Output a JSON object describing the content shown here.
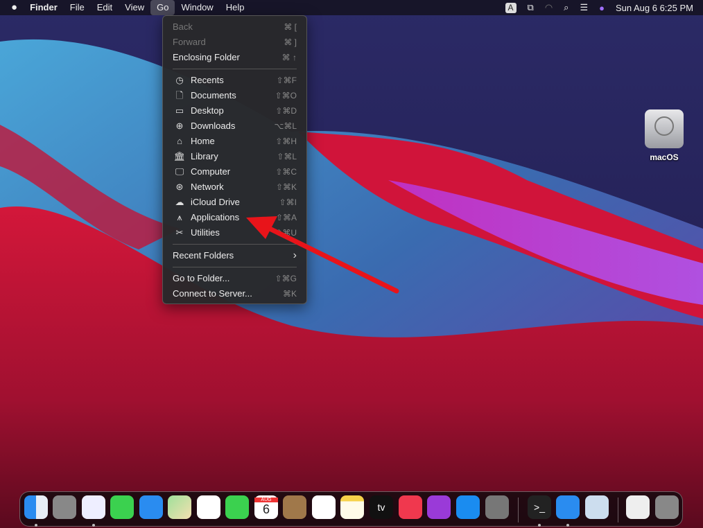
{
  "menubar": {
    "apple": "",
    "app": "Finder",
    "items": [
      "File",
      "Edit",
      "View",
      "Go",
      "Window",
      "Help"
    ],
    "input_source": "A",
    "clock": "Sun Aug 6  6:25 PM"
  },
  "go_menu": {
    "top": [
      {
        "label": "Back",
        "shortcut": "⌘ [",
        "disabled": true
      },
      {
        "label": "Forward",
        "shortcut": "⌘ ]",
        "disabled": true
      },
      {
        "label": "Enclosing Folder",
        "shortcut": "⌘ ↑"
      }
    ],
    "places": [
      {
        "label": "Recents",
        "shortcut": "⇧⌘F",
        "icon": "clock-icon",
        "glyph": "◷"
      },
      {
        "label": "Documents",
        "shortcut": "⇧⌘O",
        "icon": "document-icon",
        "glyph": "🗋"
      },
      {
        "label": "Desktop",
        "shortcut": "⇧⌘D",
        "icon": "desktop-icon",
        "glyph": "▭"
      },
      {
        "label": "Downloads",
        "shortcut": "⌥⌘L",
        "icon": "download-icon",
        "glyph": "⊕"
      },
      {
        "label": "Home",
        "shortcut": "⇧⌘H",
        "icon": "home-icon",
        "glyph": "⌂"
      },
      {
        "label": "Library",
        "shortcut": "⇧⌘L",
        "icon": "library-icon",
        "glyph": "🏛"
      },
      {
        "label": "Computer",
        "shortcut": "⇧⌘C",
        "icon": "computer-icon",
        "glyph": "🖵"
      },
      {
        "label": "Network",
        "shortcut": "⇧⌘K",
        "icon": "globe-icon",
        "glyph": "⊛"
      },
      {
        "label": "iCloud Drive",
        "shortcut": "⇧⌘I",
        "icon": "cloud-icon",
        "glyph": "☁"
      },
      {
        "label": "Applications",
        "shortcut": "⇧⌘A",
        "icon": "applications-icon",
        "glyph": "⩚"
      },
      {
        "label": "Utilities",
        "shortcut": "⇧⌘U",
        "icon": "tools-icon",
        "glyph": "✂"
      }
    ],
    "recent_folders": "Recent Folders",
    "submenu_glyph": "›",
    "bottom": [
      {
        "label": "Go to Folder...",
        "shortcut": "⇧⌘G"
      },
      {
        "label": "Connect to Server...",
        "shortcut": "⌘K"
      }
    ]
  },
  "desktop": {
    "drive_label": "macOS"
  },
  "dock": {
    "calendar_month": "AUG",
    "calendar_day": "6",
    "tv_label": "tv",
    "terminal_prompt": ">_",
    "apps": [
      "Finder",
      "Launchpad",
      "Safari",
      "Messages",
      "Mail",
      "Maps",
      "Photos",
      "FaceTime",
      "Calendar",
      "Contacts",
      "Reminders",
      "Notes",
      "TV",
      "Music",
      "Podcasts",
      "App Store",
      "System Preferences",
      "Terminal",
      "Doctor",
      "Preview",
      "Document",
      "Trash"
    ]
  },
  "colors": {
    "arrow": "#e8141a",
    "menu_bg": "#28282a"
  }
}
